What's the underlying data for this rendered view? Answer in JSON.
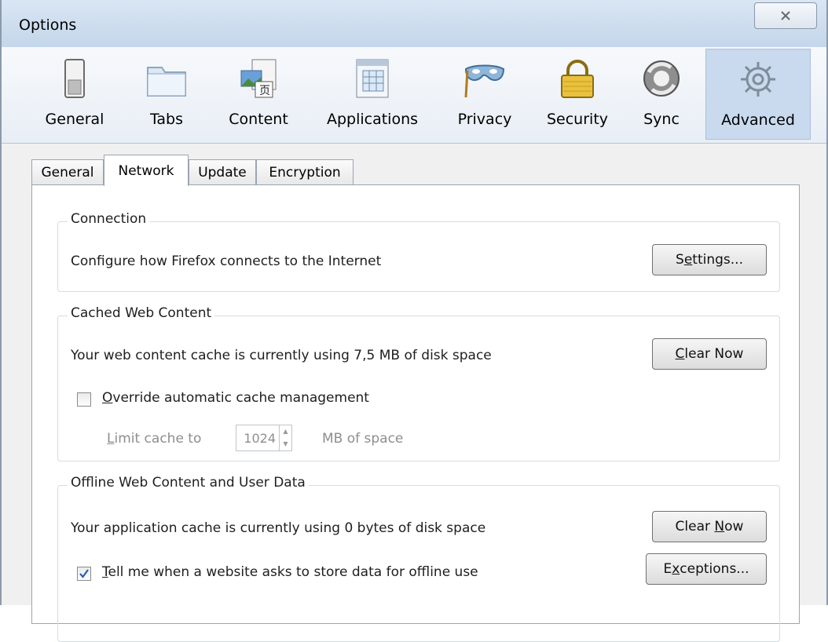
{
  "window": {
    "title": "Options",
    "close_glyph": "⌧"
  },
  "toolbar": {
    "panes": [
      {
        "label": "General",
        "icon": "general-switch-icon"
      },
      {
        "label": "Tabs",
        "icon": "tabs-folder-icon"
      },
      {
        "label": "Content",
        "icon": "content-pictures-icon"
      },
      {
        "label": "Applications",
        "icon": "applications-window-icon"
      },
      {
        "label": "Privacy",
        "icon": "privacy-mask-icon"
      },
      {
        "label": "Security",
        "icon": "security-padlock-icon"
      },
      {
        "label": "Sync",
        "icon": "sync-arrows-icon"
      },
      {
        "label": "Advanced",
        "icon": "advanced-gear-icon",
        "selected": true
      }
    ]
  },
  "subtabs": [
    {
      "label": "General"
    },
    {
      "label": "Network",
      "selected": true
    },
    {
      "label": "Update"
    },
    {
      "label": "Encryption"
    }
  ],
  "connection": {
    "legend": "Connection",
    "description": "Configure how Firefox connects to the Internet",
    "settings_pre": "S",
    "settings_key": "e",
    "settings_post": "ttings..."
  },
  "cache": {
    "legend": "Cached Web Content",
    "description": "Your web content cache is currently using 7,5 MB of disk space",
    "clear_key": "C",
    "clear_post": "lear Now",
    "override_key": "O",
    "override_post": "verride automatic cache management",
    "override_checked": false,
    "limit_key": "L",
    "limit_post": "imit cache to",
    "limit_value": "1024",
    "limit_unit": "MB of space"
  },
  "offline": {
    "legend": "Offline Web Content and User Data",
    "description": "Your application cache is currently using 0 bytes of disk space",
    "clear_pre": "Clear ",
    "clear_key": "N",
    "clear_post": "ow",
    "tell_key": "T",
    "tell_post": "ell me when a website asks to store data for offline use",
    "tell_checked": true,
    "exceptions_pre": "E",
    "exceptions_key": "x",
    "exceptions_post": "ceptions..."
  },
  "colors": {
    "selected_pane": "#c9d9ee",
    "panel_border": "#9aa5b3",
    "disabled_text": "#8e8e8e"
  }
}
